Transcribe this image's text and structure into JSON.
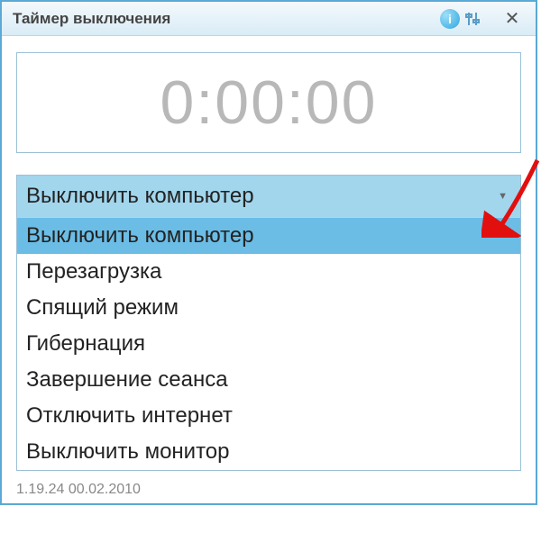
{
  "window": {
    "title": "Таймер выключения"
  },
  "timer": {
    "display": "0:00:00"
  },
  "select": {
    "current": "Выключить компьютер",
    "options": [
      "Выключить компьютер",
      "Перезагрузка",
      "Спящий режим",
      "Гибернация",
      "Завершение сеанса",
      "Отключить интернет",
      "Выключить монитор"
    ]
  },
  "footer": {
    "text": "1.19.24   00.02.2010"
  }
}
